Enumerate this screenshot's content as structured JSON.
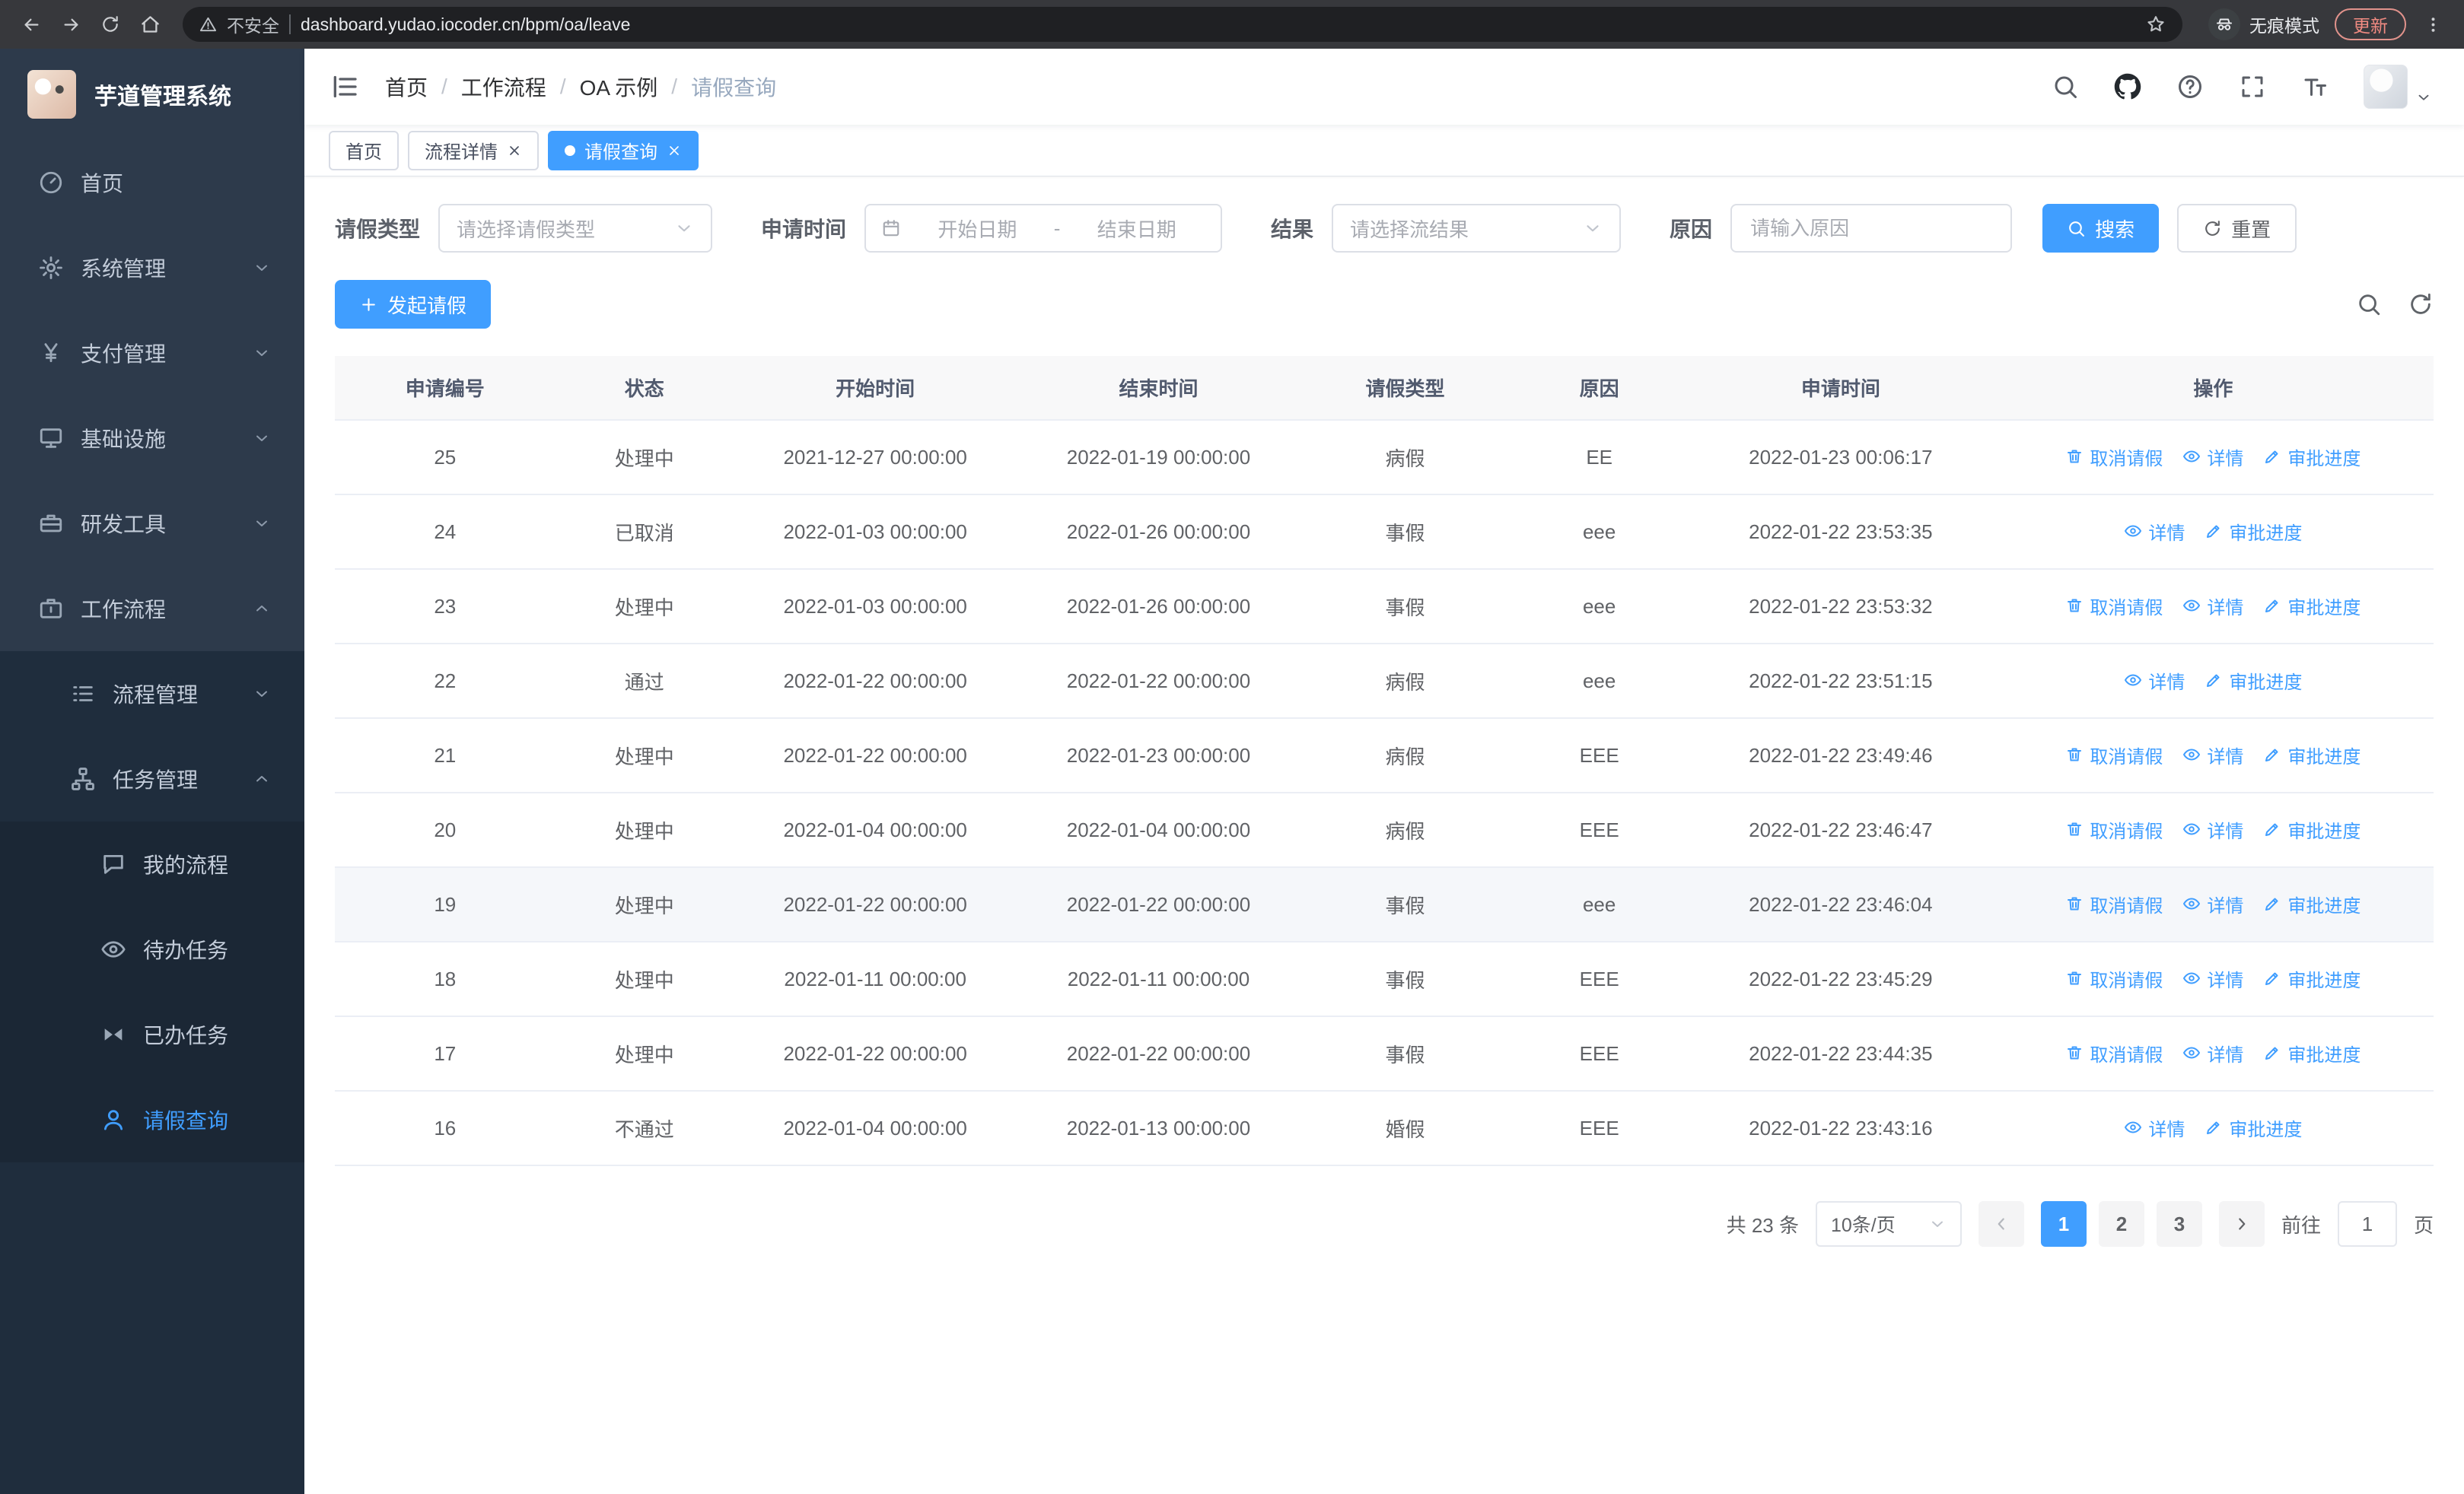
{
  "browser": {
    "security_text": "不安全",
    "url": "dashboard.yudao.iocoder.cn/bpm/oa/leave",
    "incognito_text": "无痕模式",
    "update_text": "更新"
  },
  "sidebar": {
    "title": "芋道管理系统",
    "menu": [
      {
        "key": "home",
        "label": "首页",
        "icon": "dashboard",
        "level": 1
      },
      {
        "key": "system-management",
        "label": "系统管理",
        "icon": "gear",
        "level": 1,
        "arrow": "down"
      },
      {
        "key": "payment-management",
        "label": "支付管理",
        "icon": "yen",
        "level": 1,
        "arrow": "down"
      },
      {
        "key": "infrastructure",
        "label": "基础设施",
        "icon": "monitor",
        "level": 1,
        "arrow": "down"
      },
      {
        "key": "dev-tools",
        "label": "研发工具",
        "icon": "toolbox",
        "level": 1,
        "arrow": "down"
      },
      {
        "key": "workflow",
        "label": "工作流程",
        "icon": "briefcase",
        "level": 1,
        "arrow": "up"
      },
      {
        "key": "process-management",
        "label": "流程管理",
        "icon": "list",
        "level": 2,
        "arrow": "down",
        "dark": true
      },
      {
        "key": "task-management",
        "label": "任务管理",
        "icon": "flow",
        "level": 2,
        "arrow": "up",
        "dark": true
      },
      {
        "key": "my-process",
        "label": "我的流程",
        "icon": "chat",
        "level": 3,
        "dark": true
      },
      {
        "key": "todo-tasks",
        "label": "待办任务",
        "icon": "eye",
        "level": 3,
        "dark": true
      },
      {
        "key": "done-tasks",
        "label": "已办任务",
        "icon": "bowtie",
        "level": 3,
        "dark": true
      },
      {
        "key": "leave-query",
        "label": "请假查询",
        "icon": "user",
        "level": 3,
        "dark": true,
        "active": true
      }
    ]
  },
  "header": {
    "breadcrumbs": [
      "首页",
      "工作流程",
      "OA 示例",
      "请假查询"
    ]
  },
  "tabs": [
    {
      "label": "首页",
      "closable": false,
      "active": false
    },
    {
      "label": "流程详情",
      "closable": true,
      "active": false
    },
    {
      "label": "请假查询",
      "closable": true,
      "active": true
    }
  ],
  "filters": {
    "leave_type_label": "请假类型",
    "leave_type_placeholder": "请选择请假类型",
    "time_label": "申请时间",
    "start_placeholder": "开始日期",
    "range_separator": "-",
    "end_placeholder": "结束日期",
    "result_label": "结果",
    "result_placeholder": "请选择流结果",
    "reason_label": "原因",
    "reason_placeholder": "请输入原因",
    "search_label": "搜索",
    "reset_label": "重置"
  },
  "toolbar": {
    "create_label": "发起请假"
  },
  "table": {
    "columns": [
      "申请编号",
      "状态",
      "开始时间",
      "结束时间",
      "请假类型",
      "原因",
      "申请时间",
      "操作"
    ],
    "actions_def": {
      "cancel": {
        "label": "取消请假",
        "icon": "trash"
      },
      "detail": {
        "label": "详情",
        "icon": "eye"
      },
      "progress": {
        "label": "审批进度",
        "icon": "edit"
      }
    },
    "rows": [
      {
        "id": "25",
        "status": "处理中",
        "start": "2021-12-27 00:00:00",
        "end": "2022-01-19 00:00:00",
        "type": "病假",
        "reason": "EE",
        "applied": "2022-01-23 00:06:17",
        "actions": [
          "cancel",
          "detail",
          "progress"
        ]
      },
      {
        "id": "24",
        "status": "已取消",
        "start": "2022-01-03 00:00:00",
        "end": "2022-01-26 00:00:00",
        "type": "事假",
        "reason": "eee",
        "applied": "2022-01-22 23:53:35",
        "actions": [
          "detail",
          "progress"
        ]
      },
      {
        "id": "23",
        "status": "处理中",
        "start": "2022-01-03 00:00:00",
        "end": "2022-01-26 00:00:00",
        "type": "事假",
        "reason": "eee",
        "applied": "2022-01-22 23:53:32",
        "actions": [
          "cancel",
          "detail",
          "progress"
        ]
      },
      {
        "id": "22",
        "status": "通过",
        "start": "2022-01-22 00:00:00",
        "end": "2022-01-22 00:00:00",
        "type": "病假",
        "reason": "eee",
        "applied": "2022-01-22 23:51:15",
        "actions": [
          "detail",
          "progress"
        ]
      },
      {
        "id": "21",
        "status": "处理中",
        "start": "2022-01-22 00:00:00",
        "end": "2022-01-23 00:00:00",
        "type": "病假",
        "reason": "EEE",
        "applied": "2022-01-22 23:49:46",
        "actions": [
          "cancel",
          "detail",
          "progress"
        ]
      },
      {
        "id": "20",
        "status": "处理中",
        "start": "2022-01-04 00:00:00",
        "end": "2022-01-04 00:00:00",
        "type": "病假",
        "reason": "EEE",
        "applied": "2022-01-22 23:46:47",
        "actions": [
          "cancel",
          "detail",
          "progress"
        ]
      },
      {
        "id": "19",
        "status": "处理中",
        "start": "2022-01-22 00:00:00",
        "end": "2022-01-22 00:00:00",
        "type": "事假",
        "reason": "eee",
        "applied": "2022-01-22 23:46:04",
        "actions": [
          "cancel",
          "detail",
          "progress"
        ],
        "highlight": true
      },
      {
        "id": "18",
        "status": "处理中",
        "start": "2022-01-11 00:00:00",
        "end": "2022-01-11 00:00:00",
        "type": "事假",
        "reason": "EEE",
        "applied": "2022-01-22 23:45:29",
        "actions": [
          "cancel",
          "detail",
          "progress"
        ]
      },
      {
        "id": "17",
        "status": "处理中",
        "start": "2022-01-22 00:00:00",
        "end": "2022-01-22 00:00:00",
        "type": "事假",
        "reason": "EEE",
        "applied": "2022-01-22 23:44:35",
        "actions": [
          "cancel",
          "detail",
          "progress"
        ]
      },
      {
        "id": "16",
        "status": "不通过",
        "start": "2022-01-04 00:00:00",
        "end": "2022-01-13 00:00:00",
        "type": "婚假",
        "reason": "EEE",
        "applied": "2022-01-22 23:43:16",
        "actions": [
          "detail",
          "progress"
        ]
      }
    ]
  },
  "pagination": {
    "total_text": "共 23 条",
    "size_text": "10条/页",
    "pages": [
      "1",
      "2",
      "3"
    ],
    "active_page": "1",
    "goto_label": "前往",
    "goto_value": "1",
    "page_label": "页"
  }
}
